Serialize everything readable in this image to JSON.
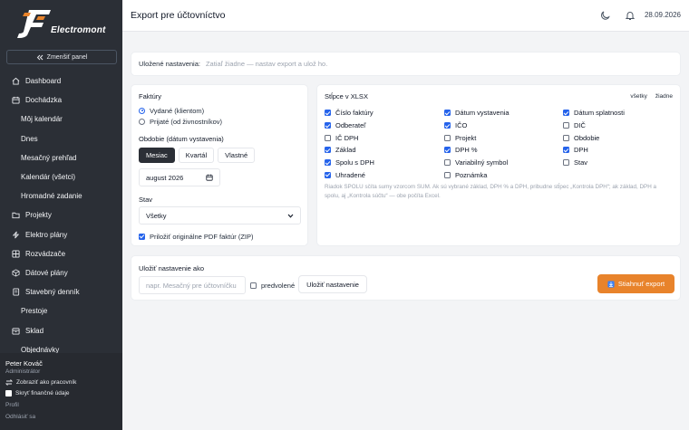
{
  "brand": {
    "logo_text": "Electromont"
  },
  "sidebar": {
    "collapse_label": "Zmenšiť panel",
    "items": [
      {
        "label": "Dashboard",
        "icon": "home-icon",
        "sub": false
      },
      {
        "label": "Dochádzka",
        "icon": "calendar-icon",
        "sub": false
      },
      {
        "label": "Môj kalendár",
        "sub": true
      },
      {
        "label": "Dnes",
        "sub": true
      },
      {
        "label": "Mesačný prehľad",
        "sub": true
      },
      {
        "label": "Kalendár (všetci)",
        "sub": true
      },
      {
        "label": "Hromadné zadanie",
        "sub": true
      },
      {
        "label": "Projekty",
        "icon": "folder-icon",
        "sub": false
      },
      {
        "label": "Elektro plány",
        "icon": "bolt-icon",
        "sub": false
      },
      {
        "label": "Rozvádzače",
        "icon": "grid-icon",
        "sub": false
      },
      {
        "label": "Dátové plány",
        "icon": "cube-icon",
        "sub": false
      },
      {
        "label": "Stavebný denník",
        "icon": "book-icon",
        "sub": false
      },
      {
        "label": "Prestoje",
        "sub": true
      },
      {
        "label": "Sklad",
        "icon": "box-icon",
        "sub": false
      },
      {
        "label": "Objednávky",
        "sub": true
      }
    ],
    "user": {
      "name": "Peter Kováč",
      "role": "Administrátor",
      "switch_label": "Zobraziť ako pracovník",
      "hide_finance_label": "Skryť finančné údaje",
      "profile_label": "Profil",
      "logout_label": "Odhlásiť sa"
    }
  },
  "header": {
    "title": "Export pre účtovníctvo",
    "date": "28.09.2026"
  },
  "saved": {
    "label": "Uložené nastavenia:",
    "value": "Zatiaľ žiadne — nastav export a ulož ho."
  },
  "invoices": {
    "title": "Faktúry",
    "options": [
      {
        "label": "Vydané (klientom)",
        "selected": true
      },
      {
        "label": "Prijaté (od živnostníkov)",
        "selected": false
      }
    ],
    "period_title": "Obdobie (dátum vystavenia)",
    "period_tabs": [
      {
        "label": "Mesiac",
        "active": true
      },
      {
        "label": "Kvartál",
        "active": false
      },
      {
        "label": "Vlastné",
        "active": false
      }
    ],
    "month_value": "august 2026",
    "status_title": "Stav",
    "status_value": "Všetky",
    "attach_pdf_label": "Priložiť originálne PDF faktúr (ZIP)"
  },
  "columns": {
    "title": "Stĺpce v XLSX",
    "all_label": "všetky",
    "none_label": "žiadne",
    "items": [
      {
        "label": "Číslo faktúry",
        "checked": true
      },
      {
        "label": "Dátum vystavenia",
        "checked": true
      },
      {
        "label": "Dátum splatnosti",
        "checked": true
      },
      {
        "label": "Odberateľ",
        "checked": true
      },
      {
        "label": "IČO",
        "checked": true
      },
      {
        "label": "DIČ",
        "checked": false
      },
      {
        "label": "IČ DPH",
        "checked": false
      },
      {
        "label": "Projekt",
        "checked": false
      },
      {
        "label": "Obdobie",
        "checked": false
      },
      {
        "label": "Základ",
        "checked": true
      },
      {
        "label": "DPH %",
        "checked": true
      },
      {
        "label": "DPH",
        "checked": true
      },
      {
        "label": "Spolu s DPH",
        "checked": true
      },
      {
        "label": "Variabilný symbol",
        "checked": false
      },
      {
        "label": "Stav",
        "checked": false
      },
      {
        "label": "Uhradené",
        "checked": true
      },
      {
        "label": "Poznámka",
        "checked": false
      }
    ],
    "note_line1": "Riadok SPOLU sčíta sumy vzorcom SUM. Ak sú vybrané základ, DPH % a DPH, pribudne stĺpec „Kontrola DPH“; ak základ, DPH a",
    "note_line2": "spolu, aj „Kontrola súčtu“ — obe počíta Excel."
  },
  "save": {
    "title": "Uložiť nastavenie ako",
    "placeholder": "napr. Mesačný pre účtovníčku",
    "default_label": "predvolené",
    "save_button": "Uložiť nastavenie",
    "download_button": "Stiahnuť export"
  },
  "colors": {
    "sidebar": "#2b2f36",
    "accent": "#2563eb",
    "download": "#e8832b"
  }
}
